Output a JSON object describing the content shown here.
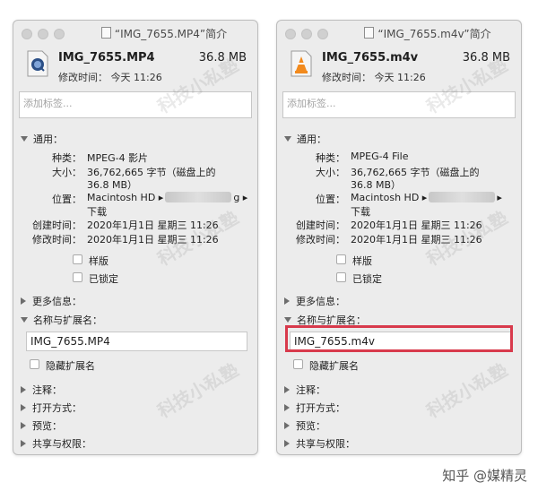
{
  "windows": [
    {
      "title": "“IMG_7655.MP4”简介",
      "file_name": "IMG_7655.MP4",
      "file_size": "36.8 MB",
      "modified_top": "修改时间：  今天 11:26",
      "tag_placeholder": "添加标签...",
      "section_general": "通用：",
      "general": {
        "kind_label": "种类：",
        "kind_value": "MPEG-4 影片",
        "size_label": "大小：",
        "size_value_1": "36,762,665 字节（磁盘上的",
        "size_value_2": "36.8 MB）",
        "where_label": "位置：",
        "where_value_a": "Macintosh HD ▸",
        "where_value_b": "g ▸",
        "where_value_c": "下载",
        "created_label": "创建时间：",
        "created_value": "2020年1月1日 星期三 11:26",
        "modified_label": "修改时间：",
        "modified_value": "2020年1月1日 星期三 11:26"
      },
      "stationery_label": "样版",
      "locked_label": "已锁定",
      "section_more_info": "更多信息：",
      "section_name_ext": "名称与扩展名：",
      "name_value": "IMG_7655.MP4",
      "hide_ext_label": "隐藏扩展名",
      "section_comments": "注释：",
      "section_open_with": "打开方式：",
      "section_preview": "预览：",
      "section_sharing": "共享与权限："
    },
    {
      "title": "“IMG_7655.m4v”简介",
      "file_name": "IMG_7655.m4v",
      "file_size": "36.8 MB",
      "modified_top": "修改时间：  今天 11:26",
      "tag_placeholder": "添加标签...",
      "section_general": "通用：",
      "general": {
        "kind_label": "种类：",
        "kind_value": "MPEG-4 File",
        "size_label": "大小：",
        "size_value_1": "36,762,665 字节（磁盘上的",
        "size_value_2": "36.8 MB）",
        "where_label": "位置：",
        "where_value_a": "Macintosh HD ▸",
        "where_value_b": "▸",
        "where_value_c": "下载",
        "created_label": "创建时间：",
        "created_value": "2020年1月1日 星期三 11:26",
        "modified_label": "修改时间：",
        "modified_value": "2020年1月1日 星期三 11:26"
      },
      "stationery_label": "样版",
      "locked_label": "已锁定",
      "section_more_info": "更多信息：",
      "section_name_ext": "名称与扩展名：",
      "name_value": "IMG_7655.m4v",
      "hide_ext_label": "隐藏扩展名",
      "section_comments": "注释：",
      "section_open_with": "打开方式：",
      "section_preview": "预览：",
      "section_sharing": "共享与权限："
    }
  ],
  "watermark_text": "科技小私塾",
  "brand_text": "知乎 @媒精灵",
  "colors": {
    "panel_bg": "#ececec",
    "highlight": "#d83a4c"
  }
}
